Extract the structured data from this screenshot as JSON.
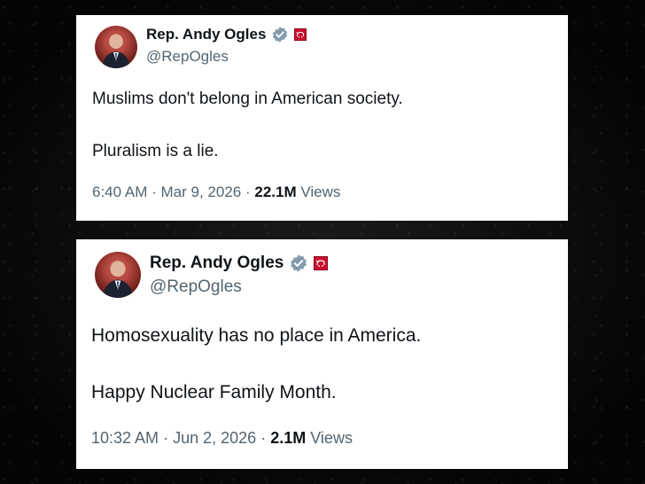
{
  "tweets": [
    {
      "author_name": "Rep. Andy Ogles",
      "handle": "@RepOgles",
      "lines": [
        "Muslims don't belong in American society.",
        "Pluralism is a lie."
      ],
      "time": "6:40 AM",
      "date": "Mar 9, 2026",
      "views_count": "22.1M",
      "views_label": "Views",
      "separator": "·"
    },
    {
      "author_name": "Rep. Andy Ogles",
      "handle": "@RepOgles",
      "lines": [
        "Homosexuality has no place in America.",
        "Happy Nuclear Family Month."
      ],
      "time": "10:32 AM",
      "date": "Jun 2, 2026",
      "views_count": "2.1M",
      "views_label": "Views",
      "separator": "·"
    }
  ],
  "icons": {
    "verified": "verified-badge-icon",
    "affiliation": "republican-affiliation-icon"
  },
  "colors": {
    "text_primary": "#0f1419",
    "text_secondary": "#536471",
    "verified_badge": "#829aab",
    "affiliation": "#c8102e"
  }
}
